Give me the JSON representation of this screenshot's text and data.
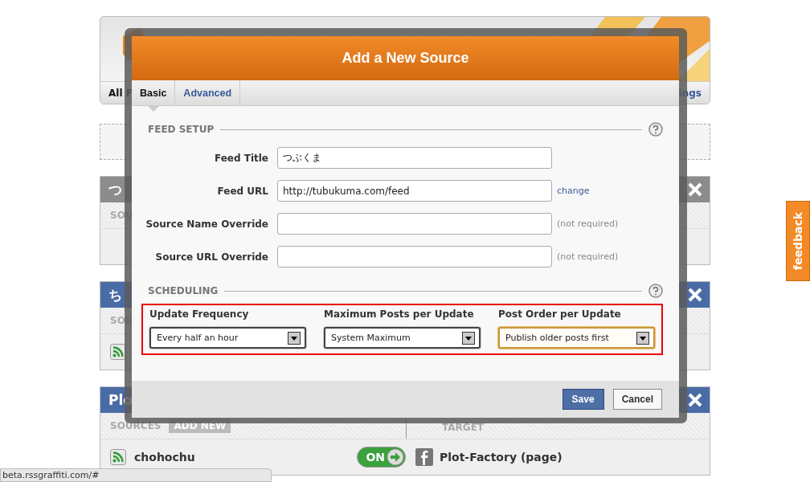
{
  "page": {
    "nav_left": "All F",
    "nav_right": "ings",
    "panels": [
      {
        "title": "つ",
        "color": "#8c8c8c",
        "subheader": "SOU"
      },
      {
        "title": "ち",
        "color": "#4a6ca6",
        "subheader": "SOU",
        "source_icon": true
      },
      {
        "title": "Plo",
        "color": "#4a6ca6",
        "sources_label": "SOURCES",
        "add_button": "ADD NEW",
        "target_label": "TARGET",
        "source_icon": true,
        "source": "chohochu",
        "toggle": {
          "label": "ON",
          "on": true
        },
        "target": "Plot-Factory (page)"
      }
    ],
    "feedback": "feedback",
    "status_bar": "beta.rssgraffiti.com/#"
  },
  "modal": {
    "title": "Add a New Source",
    "tabs": [
      {
        "label": "Basic",
        "selected": true
      },
      {
        "label": "Advanced",
        "selected": false
      }
    ],
    "feed_setup": {
      "title": "FEED SETUP",
      "fields": [
        {
          "label": "Feed Title",
          "value": "つぶくま"
        },
        {
          "label": "Feed URL",
          "value": "http://tubukuma.com/feed",
          "link": "change"
        },
        {
          "label": "Source Name Override",
          "note": "(not required)"
        },
        {
          "label": "Source URL Override",
          "note": "(not required)"
        }
      ]
    },
    "scheduling": {
      "title": "SCHEDULING",
      "highlighted": true,
      "selects": [
        {
          "label": "Update Frequency",
          "value": "Every half an hour",
          "focused": false
        },
        {
          "label": "Maximum Posts per Update",
          "value": "System Maximum",
          "focused": false
        },
        {
          "label": "Post Order per Update",
          "value": "Publish older posts first",
          "focused": true
        }
      ]
    },
    "buttons": {
      "save": "Save",
      "cancel": "Cancel"
    }
  }
}
